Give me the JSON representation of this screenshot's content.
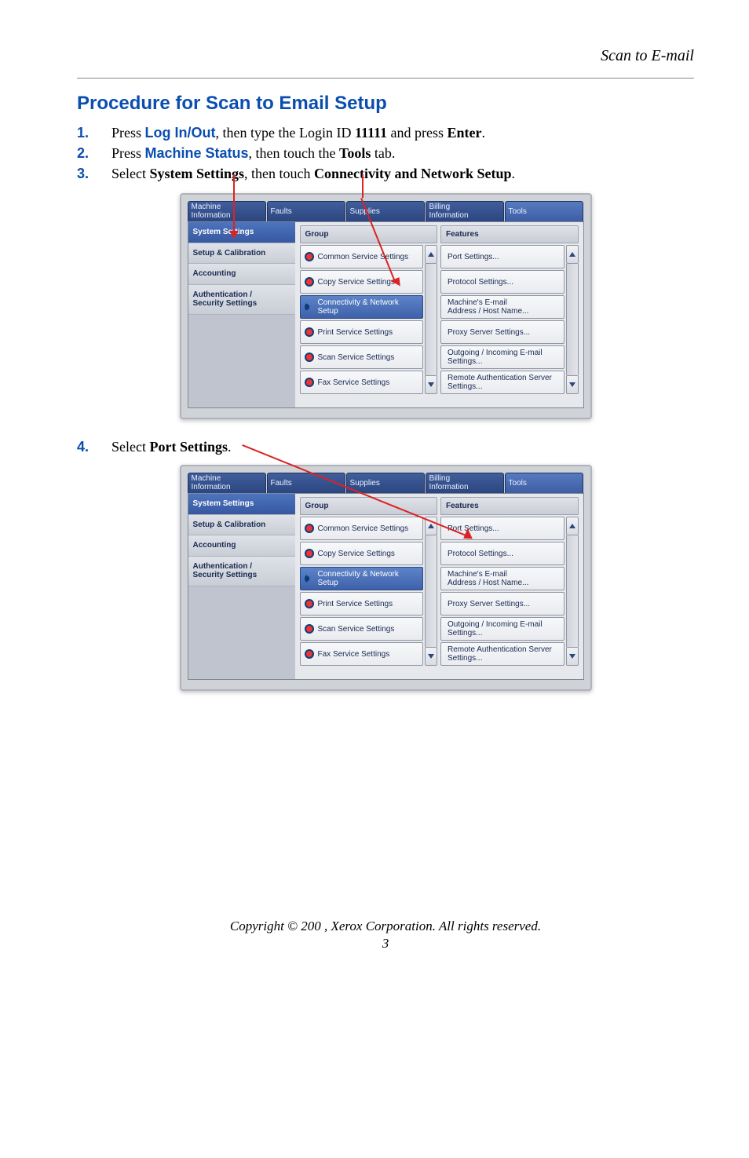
{
  "doc": {
    "section_header": "Scan to E-mail",
    "heading": "Procedure for Scan to Email Setup",
    "steps": [
      {
        "num": "1.",
        "parts": [
          "Press ",
          {
            "t": "blue",
            "v": "Log In/Out"
          },
          ", then type the Login ID ",
          {
            "t": "b",
            "v": "11111"
          },
          " and press ",
          {
            "t": "b",
            "v": "Enter"
          },
          "."
        ]
      },
      {
        "num": "2.",
        "parts": [
          "Press ",
          {
            "t": "blue",
            "v": "Machine Status"
          },
          ", then touch the ",
          {
            "t": "b",
            "v": "Tools"
          },
          " tab."
        ]
      },
      {
        "num": "3.",
        "parts": [
          "Select ",
          {
            "t": "b",
            "v": "System Settings"
          },
          ", then touch ",
          {
            "t": "b",
            "v": "Connectivity and Network Setup"
          },
          "."
        ]
      }
    ],
    "step4": {
      "num": "4.",
      "parts": [
        "Select ",
        {
          "t": "b",
          "v": "Port Settings"
        },
        "."
      ]
    },
    "footer": "Copyright © 200 , Xerox Corporation. All rights reserved.",
    "page_number": "3"
  },
  "panel_common": {
    "tabs": [
      "Machine\nInformation",
      "Faults",
      "Supplies",
      "Billing\nInformation",
      "Tools"
    ],
    "sidebar": [
      "System Settings",
      "Setup & Calibration",
      "Accounting",
      "Authentication /\nSecurity Settings"
    ],
    "col_headers": {
      "group": "Group",
      "features": "Features"
    },
    "group_items": [
      "Common Service Settings",
      "Copy Service Settings",
      "Connectivity & Network Setup",
      "Print Service Settings",
      "Scan Service Settings",
      "Fax Service Settings"
    ],
    "feature_items": [
      "Port Settings...",
      "Protocol Settings...",
      "Machine's E-mail\nAddress / Host Name...",
      "Proxy Server Settings...",
      "Outgoing / Incoming E-mail\nSettings...",
      "Remote Authentication Server\nSettings..."
    ]
  }
}
